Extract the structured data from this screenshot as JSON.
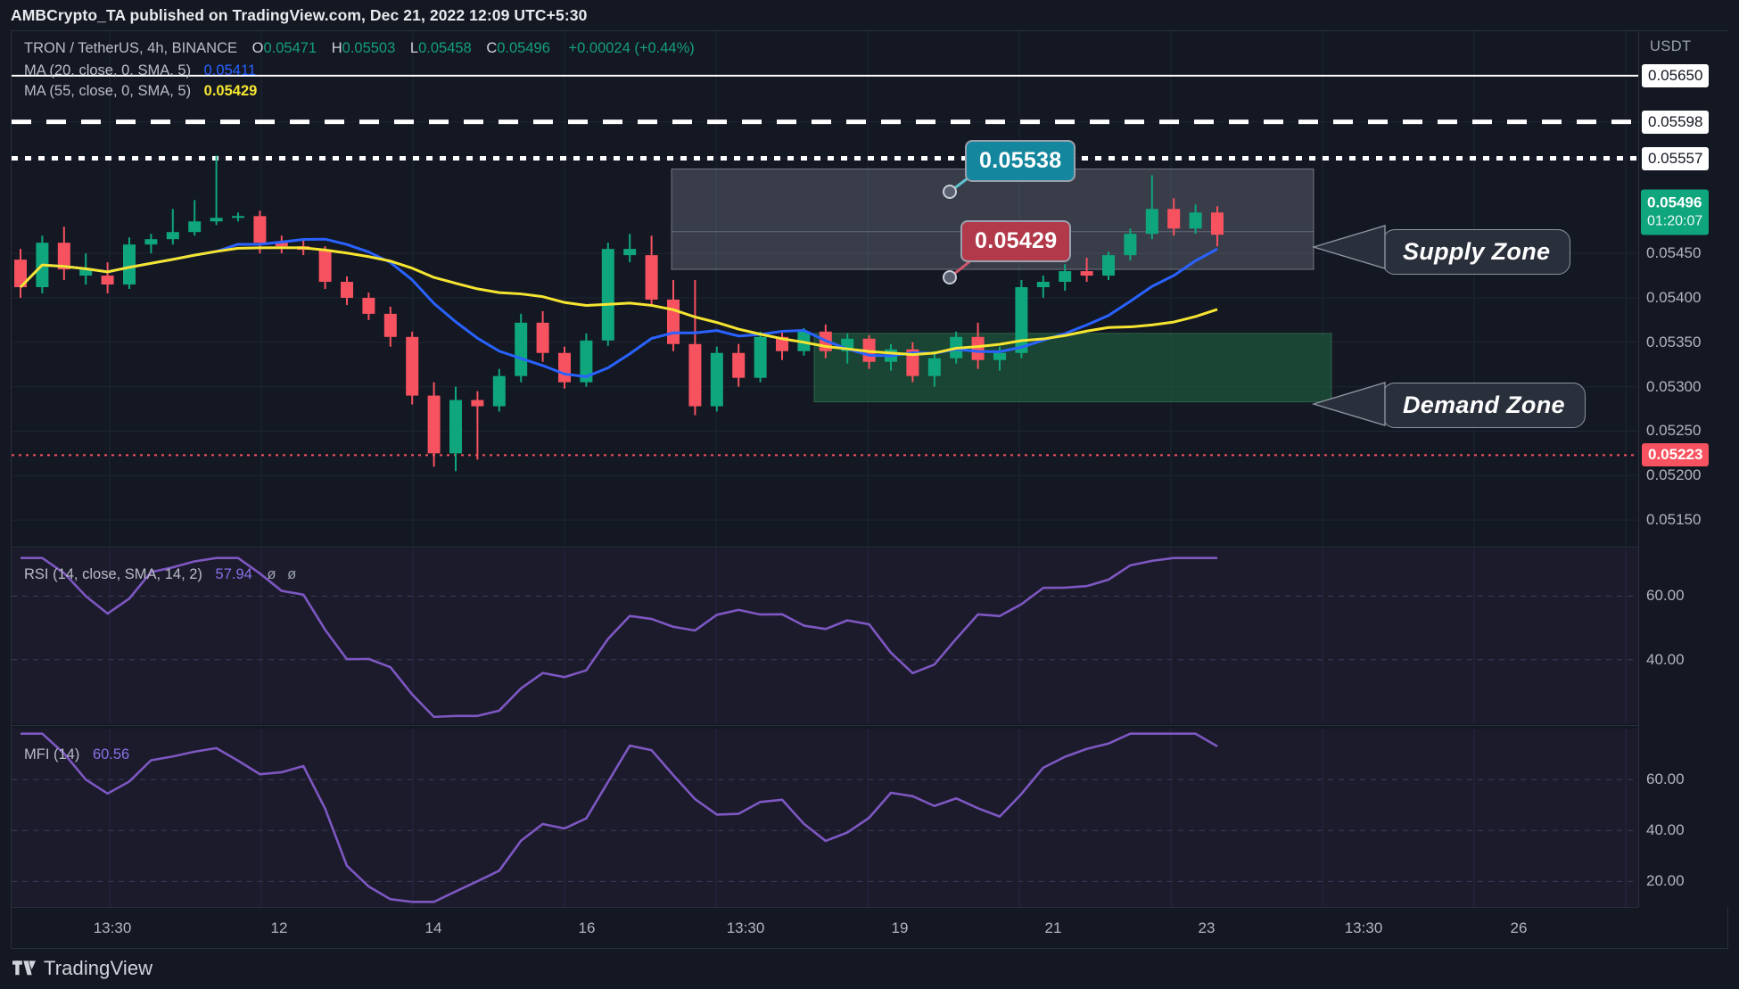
{
  "header": {
    "publisher_line": "AMBCrypto_TA published on TradingView.com, Dec 21, 2022 12:09 UTC+5:30"
  },
  "legend": {
    "symbol": "TRON / TetherUS, 4h, BINANCE",
    "open_label": "O",
    "open": "0.05471",
    "high_label": "H",
    "high": "0.05503",
    "low_label": "L",
    "low": "0.05458",
    "close_label": "C",
    "close": "0.05496",
    "change": "+0.00024 (+0.44%)",
    "ma20_name": "MA (20, close, 0, SMA, 5)",
    "ma20_value": "0.05411",
    "ma55_name": "MA (55, close, 0, SMA, 5)",
    "ma55_value": "0.05429",
    "rsi_name": "RSI (14, close, SMA, 14, 2)",
    "rsi_value": "57.94",
    "rsi_extra1": "ø",
    "rsi_extra2": "ø",
    "mfi_name": "MFI (14)",
    "mfi_value": "60.56"
  },
  "price_axis": {
    "unit": "USDT",
    "ticks": [
      "0.05650",
      "0.05598",
      "0.05557",
      "0.05450",
      "0.05400",
      "0.05350",
      "0.05300",
      "0.05250",
      "0.05200",
      "0.05150"
    ],
    "highlight_tags": [
      {
        "value": "0.05650",
        "style": "white"
      },
      {
        "value": "0.05598",
        "style": "white"
      },
      {
        "value": "0.05557",
        "style": "white"
      },
      {
        "value": "0.05496",
        "style": "green",
        "countdown": "01:20:07"
      },
      {
        "value": "0.05223",
        "style": "red"
      }
    ]
  },
  "indicator_axis": {
    "rsi_ticks": [
      "60.00",
      "40.00"
    ],
    "mfi_ticks": [
      "60.00",
      "40.00",
      "20.00"
    ]
  },
  "time_axis": {
    "labels": [
      "13:30",
      "12",
      "14",
      "16",
      "13:30",
      "19",
      "21",
      "23",
      "13:30",
      "26"
    ]
  },
  "annotations": {
    "supply_zone_label": "Supply Zone",
    "demand_zone_label": "Demand Zone",
    "callout_high": "0.05538",
    "callout_low": "0.05429"
  },
  "footer": {
    "brand": "TradingView"
  },
  "colors": {
    "background": "#141823",
    "bull": "#0fa67d",
    "bear": "#f7525f",
    "ma20": "#2962ff",
    "ma55": "#f5e531",
    "rsi": "#7e57c2",
    "supply_zone": "#bec4d2",
    "demand_zone": "#1e5f3e",
    "callout_high": "#14879e",
    "callout_low": "#b2394a"
  },
  "chart_data": {
    "type": "candlestick",
    "title": "TRON / TetherUS, 4h, BINANCE",
    "ylabel": "USDT",
    "ylim": [
      0.0512,
      0.057
    ],
    "grid": true,
    "xtick_labels": [
      "13:30",
      "12",
      "14",
      "16",
      "13:30",
      "19",
      "21",
      "23",
      "13:30",
      "26"
    ],
    "ytick_labels": [
      "0.05650",
      "0.05598",
      "0.05557",
      "0.05450",
      "0.05400",
      "0.05350",
      "0.05300",
      "0.05250",
      "0.05200",
      "0.05150"
    ],
    "levels": [
      {
        "name": "resistance-solid",
        "price": 0.0565,
        "style": "solid",
        "color": "#ffffff"
      },
      {
        "name": "resistance-dashed",
        "price": 0.05598,
        "style": "dashed",
        "color": "#ffffff"
      },
      {
        "name": "resistance-dotted",
        "price": 0.05557,
        "style": "dotted",
        "color": "#ffffff"
      },
      {
        "name": "support-dotted-red",
        "price": 0.05223,
        "style": "dotted",
        "color": "#f7525f"
      }
    ],
    "zones": [
      {
        "name": "Supply Zone",
        "top": 0.05545,
        "bottom": 0.05432,
        "color": "#bec4d2"
      },
      {
        "name": "Demand Zone",
        "top": 0.0536,
        "bottom": 0.05283,
        "color": "#1e5f3e"
      }
    ],
    "series": [
      {
        "name": "MA (20, close, 0, SMA, 5)",
        "color": "#2962ff",
        "last_value": 0.05411
      },
      {
        "name": "MA (55, close, 0, SMA, 5)",
        "color": "#f5e531",
        "last_value": 0.05429
      }
    ],
    "ohlc": [
      {
        "o": 0.05443,
        "h": 0.05455,
        "l": 0.054,
        "c": 0.05412,
        "d": "down"
      },
      {
        "o": 0.05412,
        "h": 0.0547,
        "l": 0.05405,
        "c": 0.05462,
        "d": "up"
      },
      {
        "o": 0.05462,
        "h": 0.0548,
        "l": 0.0542,
        "c": 0.05432,
        "d": "down"
      },
      {
        "o": 0.05432,
        "h": 0.0545,
        "l": 0.05415,
        "c": 0.05425,
        "d": "up"
      },
      {
        "o": 0.05425,
        "h": 0.0544,
        "l": 0.05405,
        "c": 0.05415,
        "d": "down"
      },
      {
        "o": 0.05415,
        "h": 0.05468,
        "l": 0.0541,
        "c": 0.0546,
        "d": "up"
      },
      {
        "o": 0.0546,
        "h": 0.05472,
        "l": 0.0545,
        "c": 0.05466,
        "d": "up"
      },
      {
        "o": 0.05466,
        "h": 0.055,
        "l": 0.0546,
        "c": 0.05474,
        "d": "up"
      },
      {
        "o": 0.05474,
        "h": 0.0551,
        "l": 0.0547,
        "c": 0.05486,
        "d": "up"
      },
      {
        "o": 0.05486,
        "h": 0.0556,
        "l": 0.05482,
        "c": 0.0549,
        "d": "up"
      },
      {
        "o": 0.0549,
        "h": 0.05496,
        "l": 0.05486,
        "c": 0.05492,
        "d": "up"
      },
      {
        "o": 0.05492,
        "h": 0.05498,
        "l": 0.0545,
        "c": 0.05462,
        "d": "down"
      },
      {
        "o": 0.05462,
        "h": 0.0547,
        "l": 0.0545,
        "c": 0.05458,
        "d": "down"
      },
      {
        "o": 0.05458,
        "h": 0.05466,
        "l": 0.05448,
        "c": 0.05454,
        "d": "down"
      },
      {
        "o": 0.05454,
        "h": 0.05458,
        "l": 0.0541,
        "c": 0.05418,
        "d": "down"
      },
      {
        "o": 0.05418,
        "h": 0.05424,
        "l": 0.05392,
        "c": 0.054,
        "d": "down"
      },
      {
        "o": 0.054,
        "h": 0.05406,
        "l": 0.05375,
        "c": 0.05382,
        "d": "down"
      },
      {
        "o": 0.05382,
        "h": 0.0539,
        "l": 0.05345,
        "c": 0.05356,
        "d": "down"
      },
      {
        "o": 0.05356,
        "h": 0.05362,
        "l": 0.0528,
        "c": 0.0529,
        "d": "down"
      },
      {
        "o": 0.0529,
        "h": 0.05305,
        "l": 0.0521,
        "c": 0.05225,
        "d": "down"
      },
      {
        "o": 0.05225,
        "h": 0.053,
        "l": 0.05205,
        "c": 0.05285,
        "d": "up"
      },
      {
        "o": 0.05285,
        "h": 0.05295,
        "l": 0.05218,
        "c": 0.05278,
        "d": "down"
      },
      {
        "o": 0.05278,
        "h": 0.0532,
        "l": 0.05272,
        "c": 0.05312,
        "d": "up"
      },
      {
        "o": 0.05312,
        "h": 0.05382,
        "l": 0.05305,
        "c": 0.05372,
        "d": "up"
      },
      {
        "o": 0.05372,
        "h": 0.05385,
        "l": 0.05328,
        "c": 0.05338,
        "d": "down"
      },
      {
        "o": 0.05338,
        "h": 0.05345,
        "l": 0.05298,
        "c": 0.05305,
        "d": "down"
      },
      {
        "o": 0.05305,
        "h": 0.0536,
        "l": 0.053,
        "c": 0.05352,
        "d": "up"
      },
      {
        "o": 0.05352,
        "h": 0.05462,
        "l": 0.05346,
        "c": 0.05455,
        "d": "up"
      },
      {
        "o": 0.05455,
        "h": 0.05472,
        "l": 0.0544,
        "c": 0.05448,
        "d": "up"
      },
      {
        "o": 0.05448,
        "h": 0.0547,
        "l": 0.05392,
        "c": 0.05398,
        "d": "down"
      },
      {
        "o": 0.05398,
        "h": 0.0542,
        "l": 0.0534,
        "c": 0.05348,
        "d": "down"
      },
      {
        "o": 0.05348,
        "h": 0.0542,
        "l": 0.05268,
        "c": 0.05278,
        "d": "down"
      },
      {
        "o": 0.05278,
        "h": 0.05345,
        "l": 0.05272,
        "c": 0.05338,
        "d": "up"
      },
      {
        "o": 0.05338,
        "h": 0.05348,
        "l": 0.053,
        "c": 0.0531,
        "d": "down"
      },
      {
        "o": 0.0531,
        "h": 0.05362,
        "l": 0.05305,
        "c": 0.05356,
        "d": "up"
      },
      {
        "o": 0.05356,
        "h": 0.05362,
        "l": 0.0533,
        "c": 0.0534,
        "d": "down"
      },
      {
        "o": 0.0534,
        "h": 0.05366,
        "l": 0.05335,
        "c": 0.05362,
        "d": "up"
      },
      {
        "o": 0.05362,
        "h": 0.0537,
        "l": 0.05332,
        "c": 0.0534,
        "d": "down"
      },
      {
        "o": 0.0534,
        "h": 0.0536,
        "l": 0.05326,
        "c": 0.05354,
        "d": "up"
      },
      {
        "o": 0.05354,
        "h": 0.05358,
        "l": 0.0532,
        "c": 0.05328,
        "d": "down"
      },
      {
        "o": 0.05328,
        "h": 0.05348,
        "l": 0.05318,
        "c": 0.05342,
        "d": "up"
      },
      {
        "o": 0.05342,
        "h": 0.0535,
        "l": 0.05305,
        "c": 0.05312,
        "d": "down"
      },
      {
        "o": 0.05312,
        "h": 0.0534,
        "l": 0.053,
        "c": 0.05332,
        "d": "up"
      },
      {
        "o": 0.05332,
        "h": 0.05362,
        "l": 0.05326,
        "c": 0.05356,
        "d": "up"
      },
      {
        "o": 0.05356,
        "h": 0.05372,
        "l": 0.0532,
        "c": 0.0533,
        "d": "down"
      },
      {
        "o": 0.0533,
        "h": 0.05345,
        "l": 0.05318,
        "c": 0.05338,
        "d": "up"
      },
      {
        "o": 0.05338,
        "h": 0.0542,
        "l": 0.05332,
        "c": 0.05412,
        "d": "up"
      },
      {
        "o": 0.05412,
        "h": 0.05425,
        "l": 0.054,
        "c": 0.05418,
        "d": "up"
      },
      {
        "o": 0.05418,
        "h": 0.05438,
        "l": 0.05408,
        "c": 0.0543,
        "d": "up"
      },
      {
        "o": 0.0543,
        "h": 0.05445,
        "l": 0.05418,
        "c": 0.05425,
        "d": "down"
      },
      {
        "o": 0.05425,
        "h": 0.05452,
        "l": 0.0542,
        "c": 0.05448,
        "d": "up"
      },
      {
        "o": 0.05448,
        "h": 0.05478,
        "l": 0.05442,
        "c": 0.05472,
        "d": "up"
      },
      {
        "o": 0.05472,
        "h": 0.05538,
        "l": 0.05466,
        "c": 0.055,
        "d": "up"
      },
      {
        "o": 0.055,
        "h": 0.05512,
        "l": 0.0547,
        "c": 0.05478,
        "d": "down"
      },
      {
        "o": 0.05478,
        "h": 0.05505,
        "l": 0.05472,
        "c": 0.05496,
        "d": "up"
      },
      {
        "o": 0.05496,
        "h": 0.05503,
        "l": 0.05458,
        "c": 0.05471,
        "d": "down"
      }
    ],
    "indicators": [
      {
        "type": "line",
        "name": "RSI (14, close, SMA, 14, 2)",
        "value": 57.94,
        "color": "#7e57c2",
        "ylim": [
          20,
          75
        ],
        "yticks": [
          60,
          40
        ]
      },
      {
        "type": "line",
        "name": "MFI (14)",
        "value": 60.56,
        "color": "#7e57c2",
        "ylim": [
          10,
          80
        ],
        "yticks": [
          60,
          40,
          20
        ]
      }
    ]
  }
}
